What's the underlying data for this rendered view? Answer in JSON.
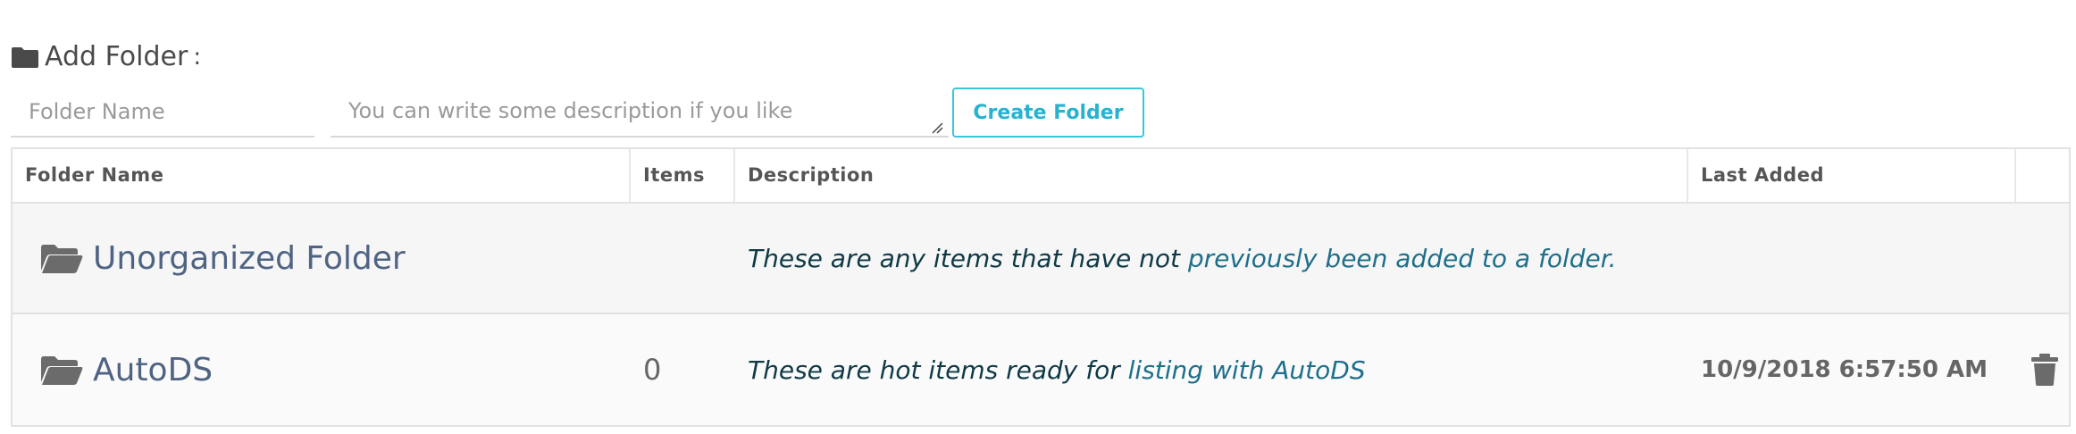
{
  "add_folder": {
    "title": "Add Folder",
    "colon": ":",
    "name_placeholder": "Folder Name",
    "description_placeholder": "You can write some description if you like",
    "create_button": "Create Folder"
  },
  "table": {
    "headers": [
      "Folder Name",
      "Items",
      "Description",
      "Last Added",
      ""
    ],
    "rows": [
      {
        "name": "Unorganized Folder",
        "items": "",
        "description_main": "These are any items that have not",
        "description_tail": " previously been added to a folder.",
        "last_added": ""
      },
      {
        "name": "AutoDS",
        "items": "0",
        "description_main": "These are hot items ready for",
        "description_tail": " listing with AutoDS",
        "last_added": "10/9/2018 6:57:50 AM"
      }
    ]
  },
  "icons": {
    "header": "folder-icon",
    "row": "folder-open-icon",
    "delete": "trash-icon"
  },
  "colors": {
    "accent": "#39c6dc",
    "folder_name": "#4f6383",
    "description": "#0f3945",
    "description_tail": "#1e6f8a"
  }
}
